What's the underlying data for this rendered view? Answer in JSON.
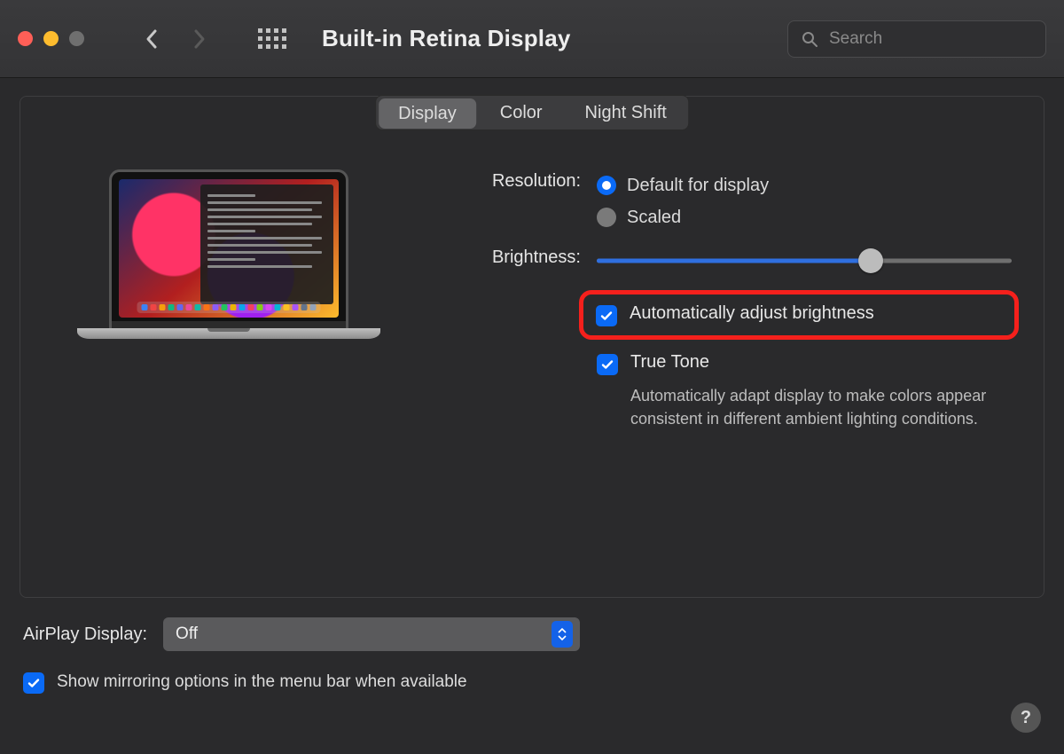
{
  "window": {
    "title": "Built-in Retina Display",
    "search_placeholder": "Search"
  },
  "tabs": {
    "items": [
      "Display",
      "Color",
      "Night Shift"
    ],
    "active": 0
  },
  "resolution": {
    "label": "Resolution:",
    "options": [
      {
        "label": "Default for display",
        "checked": true
      },
      {
        "label": "Scaled",
        "checked": false
      }
    ]
  },
  "brightness": {
    "label": "Brightness:",
    "value_pct": 66
  },
  "auto_brightness": {
    "label": "Automatically adjust brightness",
    "checked": true,
    "annotated": true
  },
  "true_tone": {
    "label": "True Tone",
    "checked": true,
    "description": "Automatically adapt display to make colors appear consistent in different ambient lighting conditions."
  },
  "airplay": {
    "label": "AirPlay Display:",
    "value": "Off"
  },
  "mirroring": {
    "label": "Show mirroring options in the menu bar when available",
    "checked": true
  },
  "help_tooltip": "?",
  "dock_colors": [
    "#3b82f6",
    "#ef4444",
    "#f59e0b",
    "#10b981",
    "#6366f1",
    "#ec4899",
    "#14b8a6",
    "#f97316",
    "#8b5cf6",
    "#22c55e",
    "#eab308",
    "#0ea5e9",
    "#f43f5e",
    "#84cc16",
    "#d946ef",
    "#06b6d4",
    "#fbbf24",
    "#a855f7",
    "#64748b",
    "#94a3b8"
  ]
}
